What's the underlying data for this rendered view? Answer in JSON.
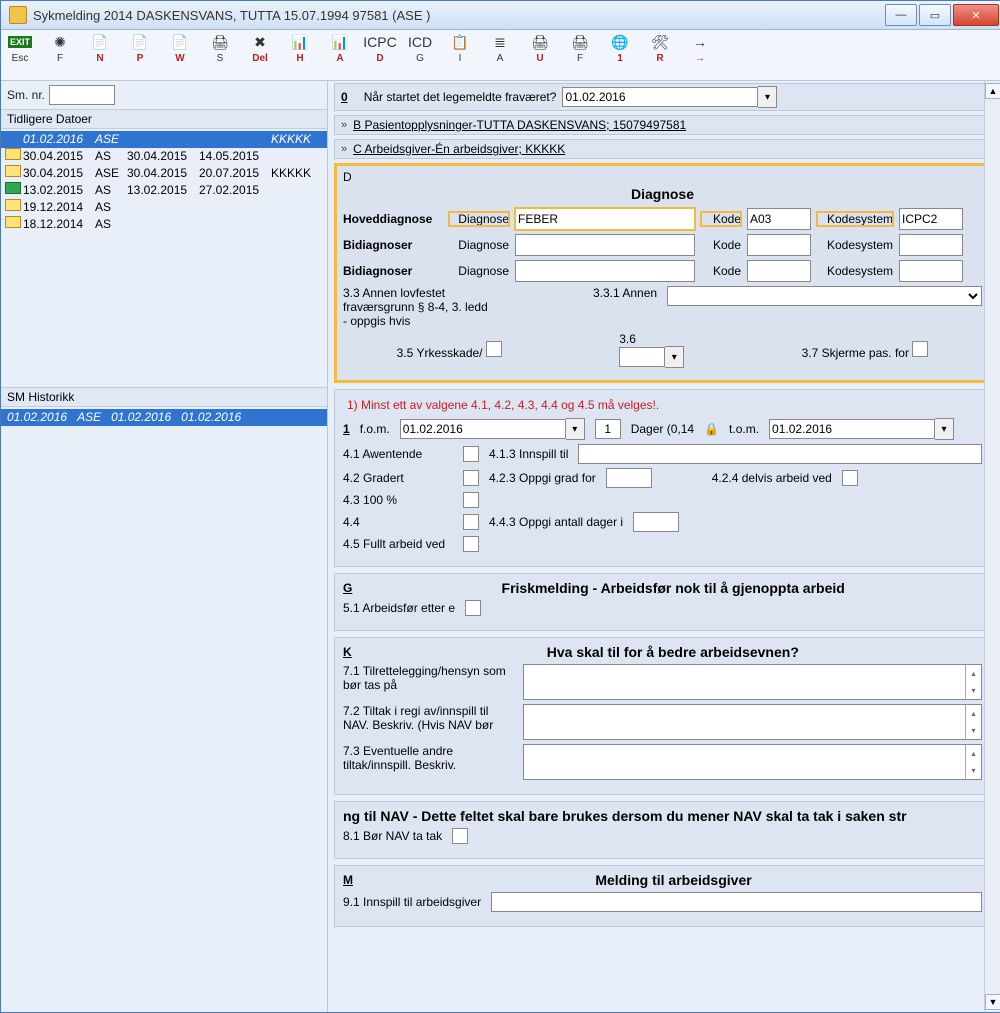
{
  "window": {
    "title": "Sykmelding 2014 DASKENSVANS, TUTTA 15.07.1994 97581 (ASE )"
  },
  "toolbar": [
    {
      "icon": "EXIT",
      "label": "Esc",
      "red": false,
      "exit": true
    },
    {
      "icon": "✺",
      "label": "F",
      "red": false
    },
    {
      "icon": "📄",
      "label": "N",
      "red": true
    },
    {
      "icon": "📄",
      "label": "P",
      "red": true
    },
    {
      "icon": "📄",
      "label": "W",
      "red": true
    },
    {
      "icon": "🖨",
      "label": "S",
      "red": false
    },
    {
      "icon": "✖",
      "label": "Del",
      "red": true
    },
    {
      "icon": "📊",
      "label": "H",
      "red": true
    },
    {
      "icon": "📊",
      "label": "A",
      "red": true
    },
    {
      "icon": "ICPC",
      "label": "D",
      "red": true
    },
    {
      "icon": "ICD",
      "label": "G",
      "red": false
    },
    {
      "icon": "📋",
      "label": "I",
      "red": false
    },
    {
      "icon": "≣",
      "label": "A",
      "red": false
    },
    {
      "icon": "🖨",
      "label": "U",
      "red": true
    },
    {
      "icon": "🖨",
      "label": "F",
      "red": false
    },
    {
      "icon": "🌐",
      "label": "1",
      "red": true
    },
    {
      "icon": "🛠",
      "label": "R",
      "red": true
    },
    {
      "icon": "→",
      "label": "→",
      "red": true
    }
  ],
  "left": {
    "sm_nr_label": "Sm. nr.",
    "sm_nr_value": "",
    "dates_header": "Tidligere Datoer",
    "dates": [
      {
        "sel": true,
        "date": "01.02.2016",
        "who": "ASE",
        "d2": "",
        "d3": "",
        "extra": "KKKKK"
      },
      {
        "sel": false,
        "date": "30.04.2015",
        "who": "AS",
        "d2": "30.04.2015",
        "d3": "14.05.2015",
        "extra": ""
      },
      {
        "sel": false,
        "date": "30.04.2015",
        "who": "ASE",
        "d2": "30.04.2015",
        "d3": "20.07.2015",
        "extra": "KKKKK"
      },
      {
        "sel": false,
        "green": true,
        "date": "13.02.2015",
        "who": "AS",
        "d2": "13.02.2015",
        "d3": "27.02.2015",
        "extra": ""
      },
      {
        "sel": false,
        "date": "19.12.2014",
        "who": "AS",
        "d2": "",
        "d3": "",
        "extra": ""
      },
      {
        "sel": false,
        "date": "18.12.2014",
        "who": "AS",
        "d2": "",
        "d3": "",
        "extra": ""
      }
    ],
    "hist_header": "SM Historikk",
    "hist": [
      {
        "sel": true,
        "c1": "01.02.2016",
        "c2": "ASE",
        "c3": "01.02.2016",
        "c4": "01.02.2016"
      }
    ]
  },
  "top": {
    "q0_num": "0",
    "q0_label": "Når startet det legemeldte fraværet?",
    "q0_value": "01.02.2016",
    "barB": "B  Pasientopplysninger-TUTTA DASKENSVANS; 15079497581",
    "barC": "C  Arbeidsgiver-Én arbeidsgiver; KKKKK"
  },
  "diag": {
    "letter": "D",
    "title": "Diagnose",
    "main": {
      "label": "Hoveddiagnose",
      "dl": "Diagnose",
      "dv": "FEBER",
      "kl": "Kode",
      "kv": "A03",
      "sl": "Kodesystem",
      "sv": "ICPC2"
    },
    "bi1": {
      "label": "Bidiagnoser",
      "dl": "Diagnose",
      "dv": "",
      "kl": "Kode",
      "kv": "",
      "sl": "Kodesystem",
      "sv": ""
    },
    "bi2": {
      "label": "Bidiagnoser",
      "dl": "Diagnose",
      "dv": "",
      "kl": "Kode",
      "kv": "",
      "sl": "Kodesystem",
      "sv": ""
    },
    "r33_label": "3.3 Annen lovfestet fraværsgrunn § 8-4, 3. ledd - oppgis hvis",
    "r331_label": "3.3.1 Annen",
    "r35_label": "3.5 Yrkesskade/",
    "r36_label": "3.6",
    "r37_label": "3.7 Skjerme pas. for"
  },
  "sec4": {
    "warn": "1) Minst ett av valgene 4.1, 4.2, 4.3, 4.4 og 4.5 må velges!.",
    "num": "1",
    "fom_l": "f.o.m.",
    "fom_v": "01.02.2016",
    "days_n": "1",
    "days_l": "Dager  (0,14",
    "tom_l": "t.o.m.",
    "tom_v": "01.02.2016",
    "r41": "4.1 Awentende",
    "r413": "4.1.3 Innspill til",
    "r42": "4.2 Gradert",
    "r423": "4.2.3 Oppgi grad for",
    "r424": "4.2.4 delvis arbeid ved",
    "r43": "4.3 100 %",
    "r44": "4.4",
    "r443": "4.4.3 Oppgi antall dager i",
    "r45": "4.5 Fullt arbeid ved"
  },
  "secG": {
    "letter": "G",
    "title": "Friskmelding - Arbeidsfør nok til å gjenoppta arbeid",
    "r51": "5.1 Arbeidsfør etter e"
  },
  "secK": {
    "letter": "K",
    "title": "Hva skal til for å bedre arbeidsevnen?",
    "r71": "7.1 Tilrettelegging/hensyn som bør tas på",
    "r72": "7.2 Tiltak i regi av/innspill til NAV. Beskriv. (Hvis NAV bør",
    "r73": "7.3 Eventuelle andre tiltak/innspill. Beskriv."
  },
  "secL": {
    "title": "ng til NAV - Dette feltet skal bare brukes dersom du mener NAV skal ta tak i saken str",
    "r81": "8.1 Bør NAV ta tak"
  },
  "secM": {
    "letter": "M",
    "title": "Melding til arbeidsgiver",
    "r91": "9.1 Innspill til arbeidsgiver"
  }
}
